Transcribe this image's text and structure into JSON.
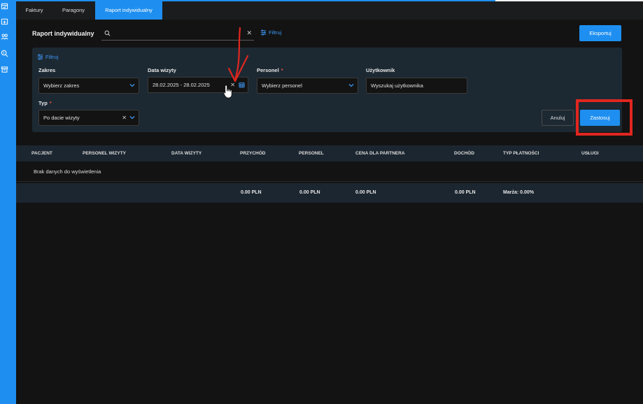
{
  "tabs": [
    {
      "label": "Faktury",
      "active": false
    },
    {
      "label": "Paragony",
      "active": false
    },
    {
      "label": "Raport indywidualny",
      "active": true
    }
  ],
  "header": {
    "title": "Raport indywidualny",
    "search_value": "",
    "filter_label": "Filtruj",
    "export_label": "Eksportuj"
  },
  "filters": {
    "title": "Filtruj",
    "zakres": {
      "label": "Zakres",
      "value": "Wybierz zakres"
    },
    "data_wizyty": {
      "label": "Data wizyty",
      "value": "28.02.2025 - 28.02.2025"
    },
    "personel": {
      "label": "Personel",
      "required_mark": "*",
      "value": "Wybierz personel"
    },
    "uzytkownik": {
      "label": "Użytkownik",
      "placeholder": "Wyszukaj użytkownika"
    },
    "typ": {
      "label": "Typ",
      "required_mark": "*",
      "value": "Po dacie wizyty"
    },
    "cancel_label": "Anuluj",
    "apply_label": "Zastosuj"
  },
  "table": {
    "columns": [
      "PACJENT",
      "PERSONEL WIZYTY",
      "DATA WIZYTY",
      "PRZYCHÓD",
      "PERSONEL",
      "CENA DLA PARTNERA",
      "DOCHÓD",
      "TYP PŁATNOŚCI",
      "USŁUGI"
    ],
    "empty_message": "Brak danych do wyświetlenia",
    "footer": {
      "przychod": "0.00 PLN",
      "personel": "0.00 PLN",
      "cena": "0.00 PLN",
      "dochod": "0.00 PLN",
      "marza": "Marża: 0.00%"
    }
  },
  "colors": {
    "accent": "#1e8ff0",
    "background": "#131313",
    "panel": "#1c2933",
    "annotation": "#e0261f"
  },
  "icons": {
    "rail": [
      "calendar-check-icon",
      "calendar-plus-icon",
      "users-icon",
      "search-dollar-icon",
      "archive-icon"
    ]
  }
}
